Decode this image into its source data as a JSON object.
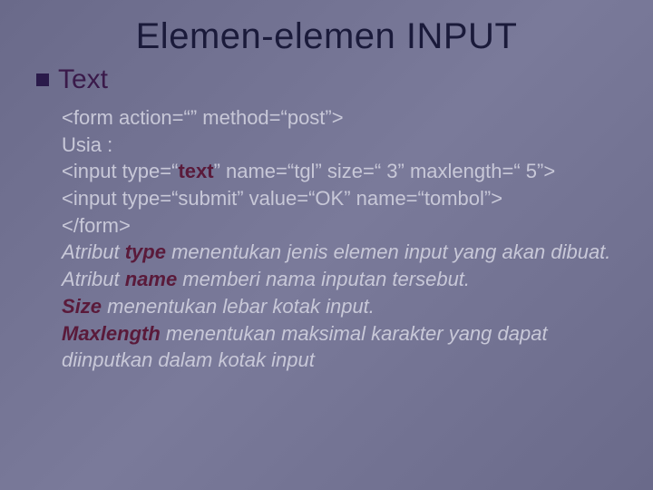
{
  "title": "Elemen-elemen INPUT",
  "subtitle": "Text",
  "code": {
    "line1_pre": "<form action=“” method=“post”>",
    "line2": "Usia :",
    "line3_a": "<input type=“",
    "line3_b": "text",
    "line3_c": "” name=“tgl” size=“ 3” maxlength=“ 5”>",
    "line4": "<input type=“submit” value=“OK” name=“tombol”>",
    "line5": "</form>"
  },
  "desc": {
    "p1_a": "Atribut ",
    "p1_b": "type",
    "p1_c": " menentukan jenis elemen input yang akan dibuat.",
    "p2_a": "Atribut ",
    "p2_b": "name",
    "p2_c": " memberi nama inputan tersebut.",
    "p3_a": "S",
    "p3_b": "ize",
    "p3_c": "  menentukan lebar kotak input.",
    "p4_a": "Maxlength",
    "p4_b": " menentukan maksimal karakter yang dapat diinputkan dalam kotak input"
  }
}
